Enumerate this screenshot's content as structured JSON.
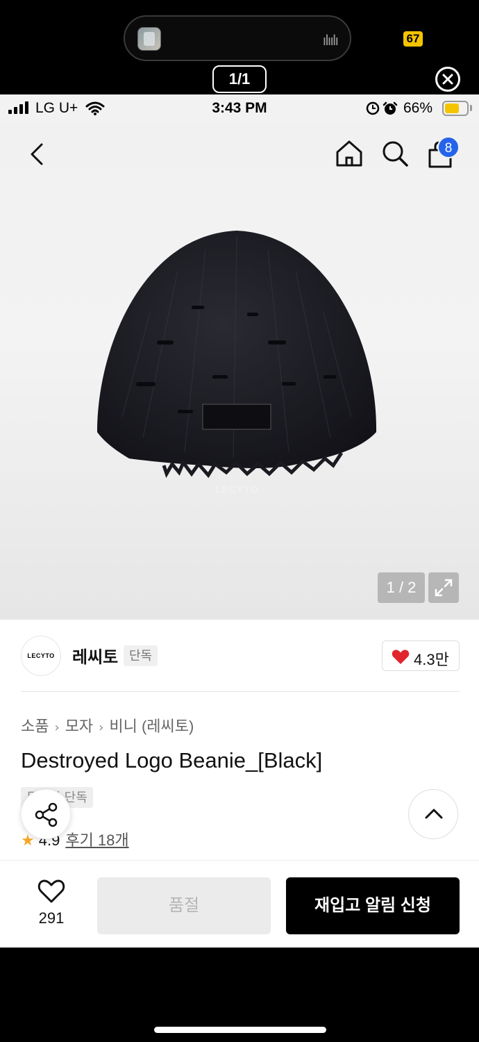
{
  "viewer": {
    "page_counter": "1/1",
    "badge_text": "67",
    "close_icon": "close-circle-icon"
  },
  "status_bar": {
    "carrier": "LG U+",
    "time": "3:43 PM",
    "battery_percent": "66%",
    "battery_level": 0.66
  },
  "nav": {
    "cart_count": "8"
  },
  "gallery": {
    "product_label_text": "LECYTO",
    "image_counter": "1 / 2"
  },
  "brand": {
    "logo_text": "LECYTO",
    "name": "레씨토",
    "tag": "단독",
    "like_count": "4.3만"
  },
  "product": {
    "breadcrumb": [
      "소품",
      "모자",
      "비니 (레씨토)"
    ],
    "title": "Destroyed Logo Beanie_[Black]",
    "badge": "무신사 단독",
    "rating": "4.9",
    "reviews": "후기 18개"
  },
  "actions": {
    "wish_count": "291",
    "soldout_label": "품절",
    "restock_label": "재입고 알림 신청"
  },
  "colors": {
    "accent_blue": "#2563eb",
    "heart_red": "#e0262c",
    "star": "#f5a623",
    "battery": "#f5c400"
  }
}
